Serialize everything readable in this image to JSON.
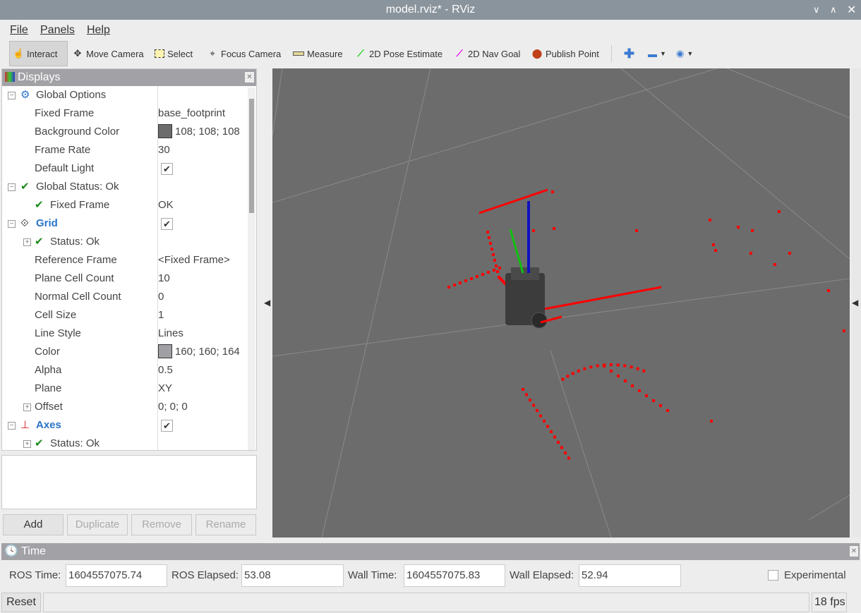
{
  "window": {
    "title": "model.rviz* - RViz"
  },
  "menu": [
    "File",
    "Panels",
    "Help"
  ],
  "toolbar": [
    {
      "label": "Interact",
      "icon": "hand-icon",
      "active": true
    },
    {
      "label": "Move Camera",
      "icon": "move-camera-icon"
    },
    {
      "label": "Select",
      "icon": "select-icon"
    },
    {
      "label": "Focus Camera",
      "icon": "focus-camera-icon"
    },
    {
      "label": "Measure",
      "icon": "ruler-icon"
    },
    {
      "label": "2D Pose Estimate",
      "icon": "green-arrow-icon"
    },
    {
      "label": "2D Nav Goal",
      "icon": "magenta-arrow-icon"
    },
    {
      "label": "Publish Point",
      "icon": "map-pin-icon"
    }
  ],
  "displays": {
    "title": "Displays",
    "rows": [
      {
        "label": "Global Options",
        "value": ""
      },
      {
        "label": "Fixed Frame",
        "value": "base_footprint"
      },
      {
        "label": "Background Color",
        "value": "108; 108; 108",
        "swatch": "#6c6c6c"
      },
      {
        "label": "Frame Rate",
        "value": "30"
      },
      {
        "label": "Default Light",
        "checked": true
      },
      {
        "label": "Global Status: Ok",
        "value": ""
      },
      {
        "label": "Fixed Frame",
        "value": "OK"
      },
      {
        "label": "Grid",
        "checked": true
      },
      {
        "label": "Status: Ok",
        "value": ""
      },
      {
        "label": "Reference Frame",
        "value": "<Fixed Frame>"
      },
      {
        "label": "Plane Cell Count",
        "value": "10"
      },
      {
        "label": "Normal Cell Count",
        "value": "0"
      },
      {
        "label": "Cell Size",
        "value": "1"
      },
      {
        "label": "Line Style",
        "value": "Lines"
      },
      {
        "label": "Color",
        "value": "160; 160; 164",
        "swatch": "#a0a0a4"
      },
      {
        "label": "Alpha",
        "value": "0.5"
      },
      {
        "label": "Plane",
        "value": "XY"
      },
      {
        "label": "Offset",
        "value": "0; 0; 0"
      },
      {
        "label": "Axes",
        "checked": true
      },
      {
        "label": "Status: Ok",
        "value": ""
      }
    ],
    "buttons": {
      "add": "Add",
      "duplicate": "Duplicate",
      "remove": "Remove",
      "rename": "Rename"
    }
  },
  "time": {
    "title": "Time",
    "ros_time_label": "ROS Time:",
    "ros_time": "1604557075.74",
    "ros_elapsed_label": "ROS Elapsed:",
    "ros_elapsed": "53.08",
    "wall_time_label": "Wall Time:",
    "wall_time": "1604557075.83",
    "wall_elapsed_label": "Wall Elapsed:",
    "wall_elapsed": "52.94",
    "experimental": "Experimental",
    "experimental_checked": false
  },
  "status": {
    "reset": "Reset",
    "fps": "18 fps"
  },
  "colors": {
    "background": "#6c6c6c",
    "laser": "#ff0000",
    "accent": "#2a74c9"
  }
}
